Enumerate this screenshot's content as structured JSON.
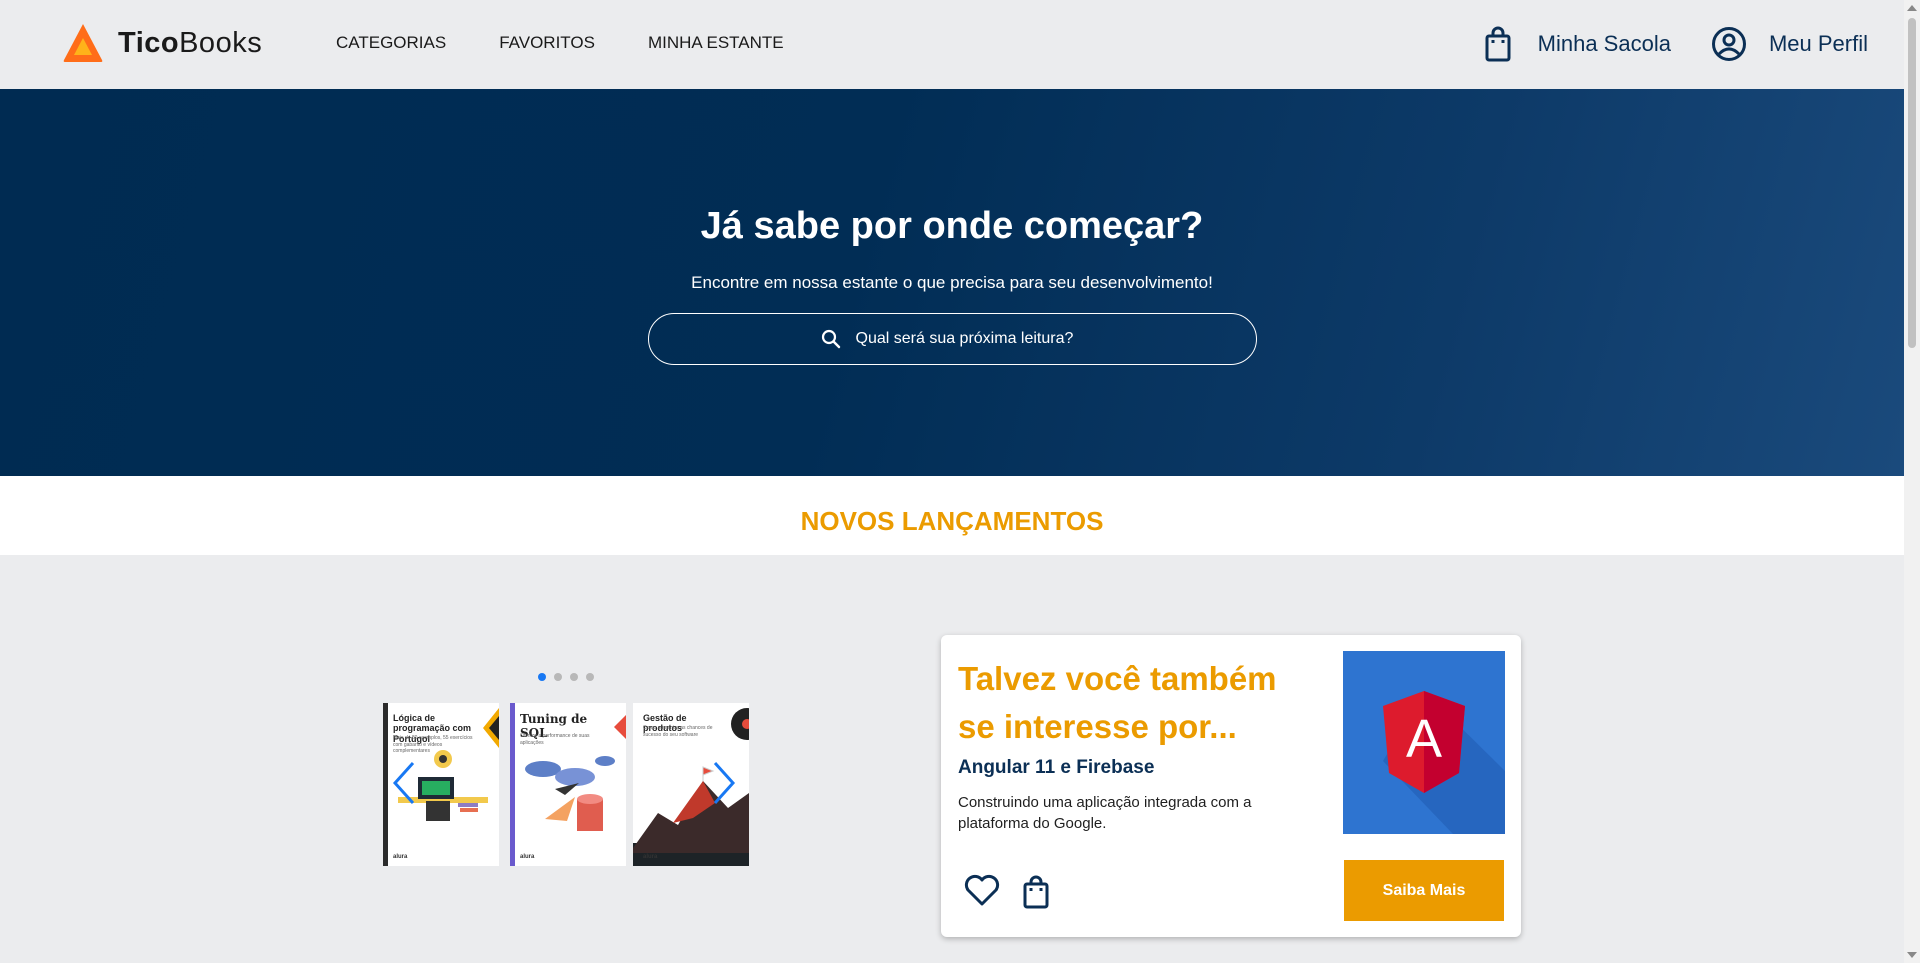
{
  "brand": {
    "name_bold": "Tico",
    "name_rest": "Books"
  },
  "nav": {
    "items": [
      {
        "label": "CATEGORIAS"
      },
      {
        "label": "FAVORITOS"
      },
      {
        "label": "MINHA ESTANTE"
      }
    ]
  },
  "header": {
    "bag_label": "Minha Sacola",
    "profile_label": "Meu Perfil",
    "bag_icon": "shopping-bag-icon",
    "profile_icon": "user-circle-icon"
  },
  "hero": {
    "title": "Já sabe por onde começar?",
    "subtitle": "Encontre em nossa estante o que precisa para seu desenvolvimento!",
    "search_placeholder": "Qual será sua próxima leitura?"
  },
  "releases": {
    "title": "NOVOS LANÇAMENTOS",
    "carousel": {
      "page_count": 4,
      "active_page": 1
    },
    "books": [
      {
        "title": "Lógica de programação com Portugol",
        "subtitle": "Mais de 80 exemplos, 55 exercícios com gabarito e vídeos complementares",
        "footer": "alura"
      },
      {
        "title": "Tuning de SQL",
        "subtitle": "Otimize a performance de suas aplicações",
        "footer": "alura"
      },
      {
        "title": "Gestão de produtos",
        "subtitle": "Como aumentar as chances de sucesso do seu software",
        "footer": "alura"
      }
    ]
  },
  "suggestion": {
    "heading": "Talvez você também se interesse por...",
    "book_title": "Angular 11 e Firebase",
    "description": "Construindo uma aplicação integrada com a plataforma do Google.",
    "cover_letter": "A",
    "button_label": "Saiba Mais"
  },
  "colors": {
    "accent": "#eb9b00",
    "navy": "#002b52",
    "link": "#1878f3",
    "background": "#ebecee"
  }
}
